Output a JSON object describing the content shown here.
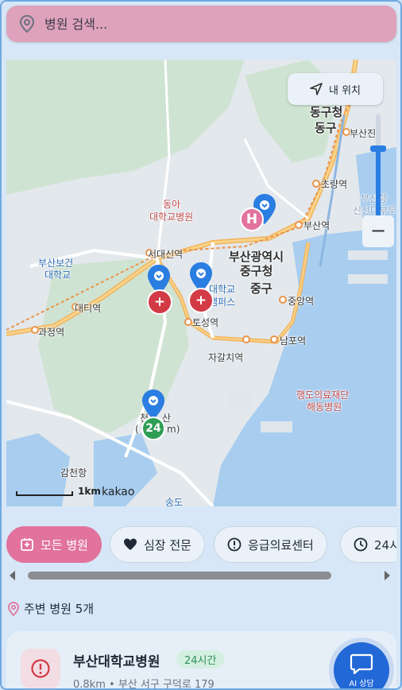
{
  "search": {
    "placeholder": "병원 검색..."
  },
  "map": {
    "my_location_label": "내 위치",
    "zoom_out_label": "−",
    "scale_label": "1km",
    "brand": "kakao",
    "labels": {
      "dong_a_1": "동아",
      "dong_a_2": "대학교병원",
      "busan_health_1": "부산보건",
      "busan_health_2": "대학교",
      "seodaesin": "서대신역",
      "daeti": "대티역",
      "gwajeong": "과정역",
      "toseong": "토성역",
      "jagalchi": "자갈치역",
      "nampo": "남포역",
      "jungang": "중앙역",
      "busan_station": "부산역",
      "choryang": "초량역",
      "busan_city_1": "부산광역시",
      "busan_city_2": "중구청",
      "junggu": "중구",
      "univ_1": "대학교",
      "univ_2": "캠퍼스",
      "dong_gu_1": "동구청",
      "dong_gu_2": "동구",
      "busanjin": "부산진",
      "bu": "부",
      "haengdo_1": "행도의료재단",
      "haengdo_2": "해동병원",
      "gamcheon": "감천항",
      "cheonmasan_1": "천",
      "cheonmasan_2": "산",
      "cheonmasan_3": "(",
      "cheonmasan_4": "m)",
      "song": "송도",
      "busan_port": "부산항",
      "busan_port_2": "신선대부두"
    },
    "pins": [
      {
        "kind": "hospital",
        "badge": "H",
        "color": "#e1739c"
      },
      {
        "kind": "emergency",
        "badge": "+",
        "color": "#d23b46"
      },
      {
        "kind": "emergency",
        "badge": "+",
        "color": "#d23b46"
      },
      {
        "kind": "24h",
        "badge": "24",
        "color": "#2e9e55"
      }
    ]
  },
  "filters": [
    {
      "label": "모든 병원",
      "icon": "hospital-icon",
      "active": true
    },
    {
      "label": "심장 전문",
      "icon": "heart-icon",
      "active": false
    },
    {
      "label": "응급의료센터",
      "icon": "alert-icon",
      "active": false
    },
    {
      "label": "24시",
      "icon": "clock-icon",
      "active": false
    }
  ],
  "nearby": {
    "label": "주변 병원 5개"
  },
  "card": {
    "name": "부산대학교병원",
    "badge": "24시간",
    "distance": "0.8km",
    "separator": "•",
    "address": "부산 서구 구덕로 179"
  },
  "ai": {
    "label": "AI 상담"
  },
  "colors": {
    "accent": "#e1739c",
    "primary": "#2268d6",
    "emergency": "#d23b46",
    "open24": "#2e9e55"
  }
}
